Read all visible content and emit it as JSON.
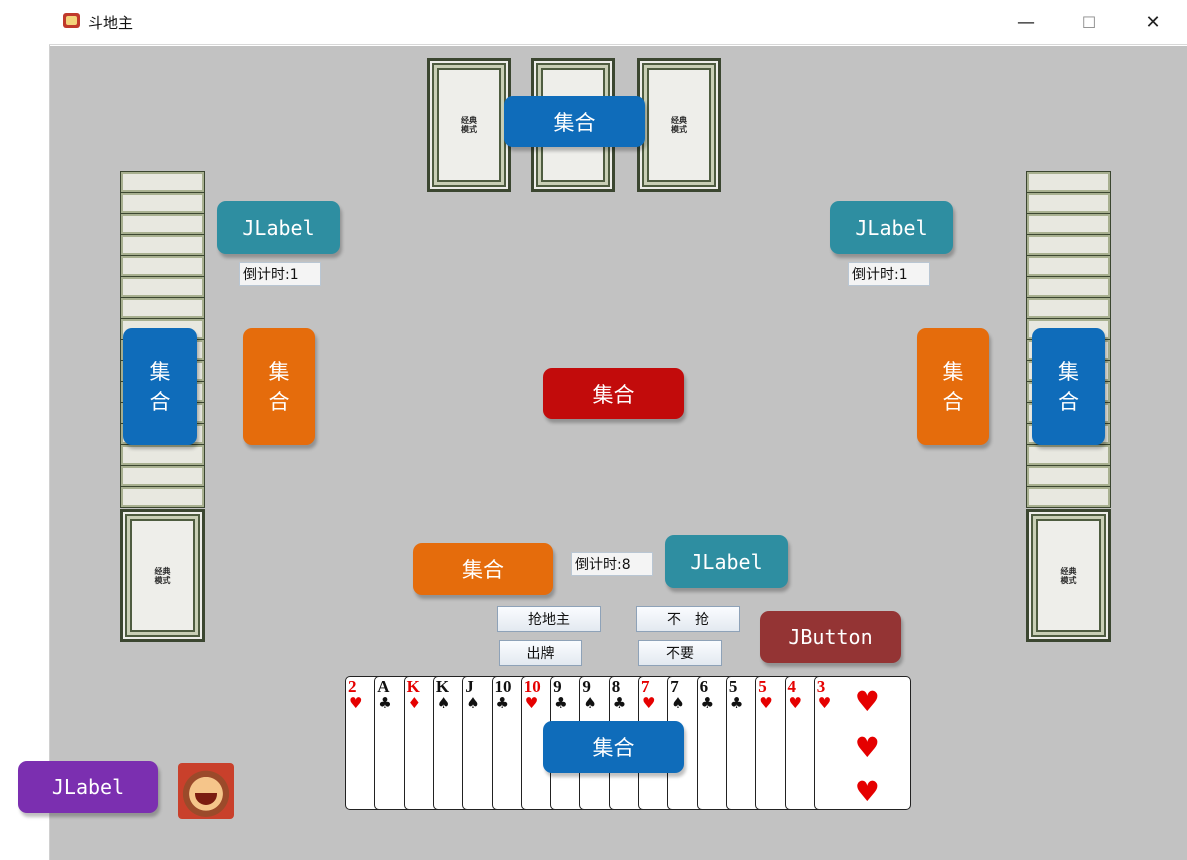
{
  "window": {
    "title": "斗地主",
    "controls": {
      "minimize": "—",
      "maximize": "☐",
      "close": "✕"
    }
  },
  "labels": {
    "top_center": "集合",
    "left_player_name": "JLabel",
    "right_player_name": "JLabel",
    "left_outer_vertical": [
      "集",
      "合"
    ],
    "left_inner_vertical": [
      "集",
      "合"
    ],
    "right_inner_vertical": [
      "集",
      "合"
    ],
    "right_outer_vertical": [
      "集",
      "合"
    ],
    "center": "集合",
    "bottom_orange": "集合",
    "bottom_player_name": "JLabel",
    "hand_overlay": "集合",
    "self_label": "JLabel"
  },
  "timers": {
    "left": "倒计时:1",
    "right": "倒计时:1",
    "bottom": "倒计时:8"
  },
  "buttons": {
    "grab_landlord": "抢地主",
    "no_grab": "不　抢",
    "play": "出牌",
    "pass": "不要",
    "jbutton": "JButton"
  },
  "hand": [
    {
      "rank": "2",
      "suit": "♥",
      "color": "red"
    },
    {
      "rank": "A",
      "suit": "♣",
      "color": "black"
    },
    {
      "rank": "K",
      "suit": "♦",
      "color": "red"
    },
    {
      "rank": "K",
      "suit": "♠",
      "color": "black"
    },
    {
      "rank": "J",
      "suit": "♠",
      "color": "black"
    },
    {
      "rank": "10",
      "suit": "♣",
      "color": "black"
    },
    {
      "rank": "10",
      "suit": "♥",
      "color": "red"
    },
    {
      "rank": "9",
      "suit": "♣",
      "color": "black"
    },
    {
      "rank": "9",
      "suit": "♠",
      "color": "black"
    },
    {
      "rank": "8",
      "suit": "♣",
      "color": "black"
    },
    {
      "rank": "7",
      "suit": "♥",
      "color": "red"
    },
    {
      "rank": "7",
      "suit": "♠",
      "color": "black"
    },
    {
      "rank": "6",
      "suit": "♣",
      "color": "black"
    },
    {
      "rank": "5",
      "suit": "♣",
      "color": "black"
    },
    {
      "rank": "5",
      "suit": "♥",
      "color": "red"
    },
    {
      "rank": "4",
      "suit": "♥",
      "color": "red"
    },
    {
      "rank": "3",
      "suit": "♥",
      "color": "red"
    }
  ],
  "colors": {
    "table": "#c2c2c2",
    "blue_label": "#0f6cba",
    "orange_label": "#e56c0c",
    "red_label": "#c20b0b",
    "teal_label": "#2e8ea1",
    "purple_label": "#7b2fb0",
    "maroon_button": "#943434"
  },
  "icons": {
    "app": "poker-app-icon",
    "avatar": "cartoon-player-avatar"
  }
}
